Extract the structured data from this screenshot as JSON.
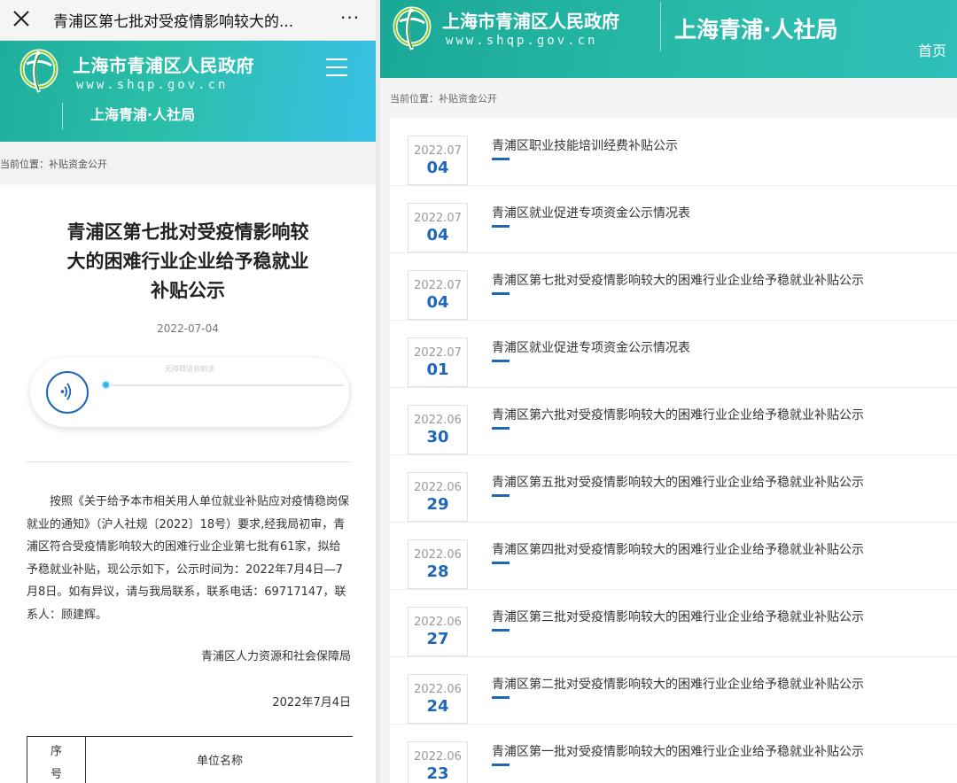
{
  "left": {
    "topbar": {
      "title": "青浦区第七批对受疫情影响较大的...",
      "more_label": "···"
    },
    "header": {
      "site_name": "上海市青浦区人民政府",
      "site_url": "www.shqp.gov.cn",
      "bureau": "上海青浦·人社局"
    },
    "breadcrumb": "当前位置：补贴资金公开",
    "article": {
      "title_lines": [
        "青浦区第七批对受疫情影响较",
        "大的困难行业企业给予稳就业",
        "补贴公示"
      ],
      "date": "2022-07-04",
      "audio_hint": "无障碍语音朗读",
      "audio_progress": 0,
      "body": "按照《关于给予本市相关用人单位就业补贴应对疫情稳岗保就业的通知》（沪人社规〔2022〕18号）要求,经我局初审，青浦区符合受疫情影响较大的困难行业企业第七批有61家，拟给予稳就业补贴，现公示如下，公示时间为：2022年7月4日—7月8日。如有异议，请与我局联系，联系电话：69717147，联系人：顾建辉。",
      "signature": "青浦区人力资源和社会保障局",
      "signature_date": "2022年7月4日"
    },
    "table": {
      "col1_line1": "序",
      "col1_line2": "号",
      "col2": "单位名称"
    }
  },
  "right": {
    "header": {
      "site_name": "上海市青浦区人民政府",
      "site_url": "www.shqp.gov.cn",
      "bureau": "上海青浦·人社局",
      "home": "首页"
    },
    "breadcrumb": "当前位置：补贴资金公开",
    "items": [
      {
        "ym": "2022.07",
        "day": "04",
        "title": "青浦区职业技能培训经费补贴公示"
      },
      {
        "ym": "2022.07",
        "day": "04",
        "title": "青浦区就业促进专项资金公示情况表"
      },
      {
        "ym": "2022.07",
        "day": "04",
        "title": "青浦区第七批对受疫情影响较大的困难行业企业给予稳就业补贴公示"
      },
      {
        "ym": "2022.07",
        "day": "01",
        "title": "青浦区就业促进专项资金公示情况表"
      },
      {
        "ym": "2022.06",
        "day": "30",
        "title": "青浦区第六批对受疫情影响较大的困难行业企业给予稳就业补贴公示"
      },
      {
        "ym": "2022.06",
        "day": "29",
        "title": "青浦区第五批对受疫情影响较大的困难行业企业给予稳就业补贴公示"
      },
      {
        "ym": "2022.06",
        "day": "28",
        "title": "青浦区第四批对受疫情影响较大的困难行业企业给予稳就业补贴公示"
      },
      {
        "ym": "2022.06",
        "day": "27",
        "title": "青浦区第三批对受疫情影响较大的困难行业企业给予稳就业补贴公示"
      },
      {
        "ym": "2022.06",
        "day": "24",
        "title": "青浦区第二批对受疫情影响较大的困难行业企业给予稳就业补贴公示"
      },
      {
        "ym": "2022.06",
        "day": "23",
        "title": "青浦区第一批对受疫情影响较大的困难行业企业给予稳就业补贴公示"
      }
    ]
  },
  "colors": {
    "header_teal": "#27b9a7",
    "accent_blue": "#1f66b8",
    "audio_knob": "#34b3f0"
  },
  "icons": {
    "close": "close-icon",
    "more": "more-icon",
    "menu": "hamburger-menu-icon",
    "logo": "shqp-logo-icon",
    "audio": "audio-play-icon"
  }
}
